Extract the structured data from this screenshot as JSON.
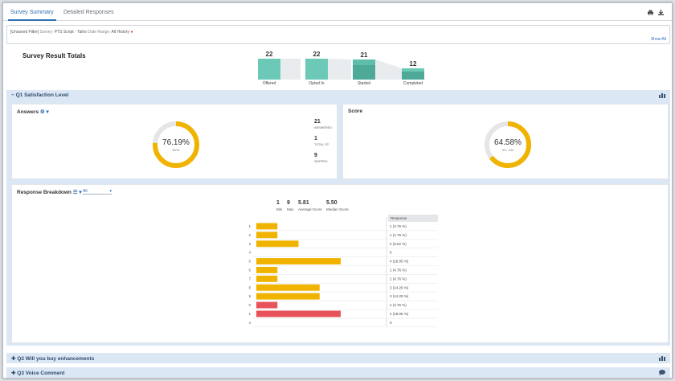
{
  "tabs": [
    {
      "label": "Survey Summary",
      "active": true
    },
    {
      "label": "Detailed Responses",
      "active": false
    }
  ],
  "toolbar": {
    "print_icon": "printer-icon",
    "download_icon": "download-icon"
  },
  "filters": {
    "unsaved": "[Unsaved Filter]",
    "survey_label": "Survey:",
    "survey_value": "PTS Script - Taiho",
    "date_label": "Date Range:",
    "date_value": "All History",
    "show_all": "Show All"
  },
  "totals": {
    "title": "Survey Result Totals",
    "stages": [
      {
        "label": "Offered",
        "count": 22
      },
      {
        "label": "Opted In",
        "count": 22
      },
      {
        "label": "Started",
        "count": 21
      },
      {
        "label": "Completed",
        "count": 12
      }
    ]
  },
  "q1": {
    "title": "Q1 Satisfaction Level",
    "answers_title": "Answers",
    "answers_pct": "76.19%",
    "answers_sub": "16/21",
    "answers_fraction": 0.7619,
    "stats": [
      {
        "num": "21",
        "label": "ANSWERED"
      },
      {
        "num": "1",
        "label": "TOTAL CP"
      },
      {
        "num": "9",
        "label": "SKIPPED"
      }
    ],
    "score_title": "Score",
    "score_pct": "64.58%",
    "score_sub": "93 / 144",
    "score_fraction": 0.6458
  },
  "breakdown": {
    "title": "Response Breakdown",
    "dropdown": "All",
    "summary": [
      {
        "num": "1",
        "label": "Min"
      },
      {
        "num": "9",
        "label": "Max"
      },
      {
        "num": "5.81",
        "label": "Average Score"
      },
      {
        "num": "5.50",
        "label": "Median Score"
      }
    ],
    "response_header": "Response",
    "rows": [
      {
        "label": "1",
        "value": 1,
        "response": "1 (4.76 %)",
        "color": "#f0b400"
      },
      {
        "label": "2",
        "value": 1,
        "response": "1 (4.76 %)",
        "color": "#f0b400"
      },
      {
        "label": "3",
        "value": 2,
        "response": "2 (9.52 %)",
        "color": "#f0b400"
      },
      {
        "label": "4",
        "value": 0,
        "response": "0",
        "color": "#f0b400"
      },
      {
        "label": "5",
        "value": 4,
        "response": "4 (19.05 %)",
        "color": "#f0b400"
      },
      {
        "label": "6",
        "value": 1,
        "response": "1 (4.76 %)",
        "color": "#f0b400"
      },
      {
        "label": "7",
        "value": 1,
        "response": "1 (4.76 %)",
        "color": "#f0b400"
      },
      {
        "label": "8",
        "value": 3,
        "response": "3 (14.29 %)",
        "color": "#f0b400"
      },
      {
        "label": "9",
        "value": 3,
        "response": "3 (14.29 %)",
        "color": "#f0b400"
      },
      {
        "label": "0",
        "value": 1,
        "response": "1 (4.76 %)",
        "color": "#e8525a"
      },
      {
        "label": "1",
        "value": 4,
        "response": "4 (19.05 %)",
        "color": "#e8525a"
      },
      {
        "label": "4",
        "value": 0,
        "response": "0",
        "color": "#f0b400"
      }
    ]
  },
  "q2": {
    "title": "Q2 Will you buy enhancements"
  },
  "q3": {
    "title": "Q3 Voice Comment"
  },
  "colors": {
    "accent": "#2e6fb5",
    "teal": "#6cc9b8",
    "teal_dark": "#4fa998",
    "gold": "#f0b400",
    "red": "#e8525a"
  }
}
